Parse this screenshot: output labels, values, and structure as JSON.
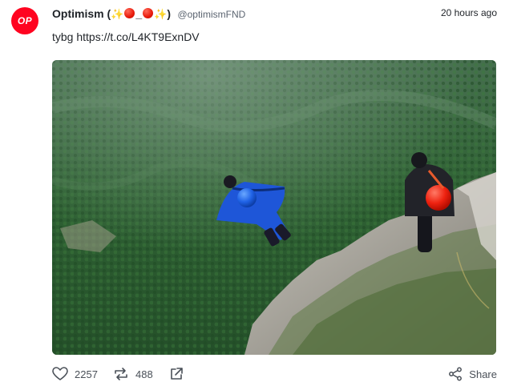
{
  "post": {
    "avatar_text": "OP",
    "author_name": "Optimism",
    "title_open": " (",
    "sparkle": "✨",
    "underscore": "_",
    "title_close": ")",
    "handle": "@optimismFND",
    "timestamp": "20 hours ago",
    "text": "tybg https://t.co/L4KT9ExnDV"
  },
  "actions": {
    "likes": "2257",
    "reposts": "488",
    "share_label": "Share"
  },
  "icons": {
    "like": "heart-icon",
    "repost": "repost-icon",
    "external": "external-link-icon",
    "share": "share-icon"
  },
  "colors": {
    "brand": "#ff0420",
    "forest": "#2f5a35",
    "suit": "#1e56d8"
  }
}
